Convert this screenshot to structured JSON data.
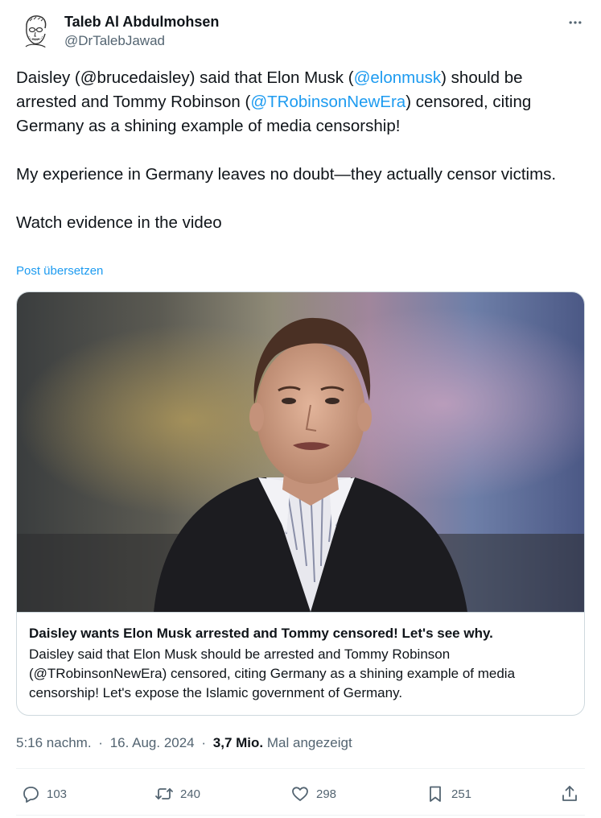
{
  "author": {
    "name": "Taleb Al Abdulmohsen",
    "handle": "@DrTalebJawad"
  },
  "tweet": {
    "p1_a": "Daisley (@brucedaisley) said that Elon Musk (",
    "p1_m1": "@elonmusk",
    "p1_b": ") should be arrested and Tommy Robinson (",
    "p1_m2": "@TRobinsonNewEra",
    "p1_c": ") censored, citing Germany as a shining example of media censorship!",
    "p2": "My experience in Germany leaves no doubt—they actually censor victims.",
    "p3": "Watch evidence in the video",
    "translate": "Post übersetzen"
  },
  "card": {
    "title": "Daisley wants Elon Musk arrested and Tommy censored! Let's see why.",
    "description": "Daisley said that Elon Musk should be arrested and Tommy Robinson (@TRobinsonNewEra) censored, citing Germany as a shining example of media censorship! Let's expose the Islamic government of Germany."
  },
  "meta": {
    "time": "5:16 nachm.",
    "sep1": "·",
    "date": "16. Aug. 2024",
    "sep2": "·",
    "views": "3,7 Mio.",
    "views_label": "Mal angezeigt"
  },
  "actions": {
    "replies": "103",
    "reposts": "240",
    "likes": "298",
    "bookmarks": "251"
  },
  "icons": {
    "more": "more-icon",
    "reply": "reply-icon",
    "repost": "repost-icon",
    "like": "heart-icon",
    "bookmark": "bookmark-icon",
    "share": "share-icon"
  },
  "colors": {
    "accent": "#1d9bf0",
    "text": "#0f1419",
    "secondary": "#536471",
    "border": "#cfd9de"
  }
}
